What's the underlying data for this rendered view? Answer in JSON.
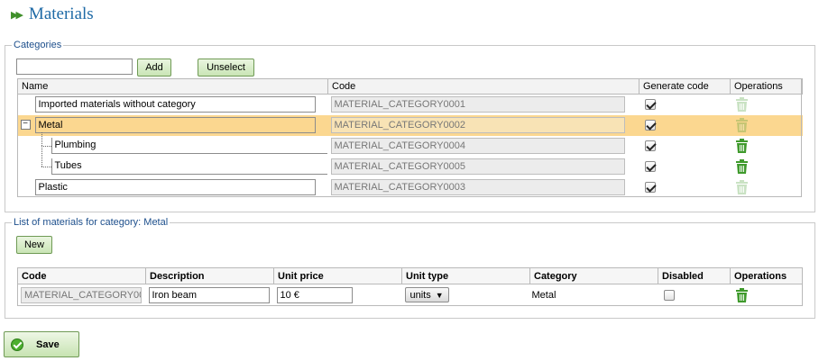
{
  "page": {
    "title": "Materials"
  },
  "categories": {
    "legend": "Categories",
    "search_value": "",
    "add_label": "Add",
    "unselect_label": "Unselect",
    "columns": {
      "name": "Name",
      "code": "Code",
      "generate_code": "Generate code",
      "operations": "Operations"
    },
    "rows": [
      {
        "name": "Imported materials without category",
        "code": "MATERIAL_CATEGORY0001",
        "generate_code": true,
        "deletable": false
      },
      {
        "name": "Metal",
        "code": "MATERIAL_CATEGORY0002",
        "generate_code": true,
        "deletable": false,
        "selected": true,
        "expanded": true
      },
      {
        "name": "Plumbing",
        "code": "MATERIAL_CATEGORY0004",
        "generate_code": true,
        "deletable": true,
        "child": true
      },
      {
        "name": "Tubes",
        "code": "MATERIAL_CATEGORY0005",
        "generate_code": true,
        "deletable": true,
        "child": true
      },
      {
        "name": "Plastic",
        "code": "MATERIAL_CATEGORY0003",
        "generate_code": true,
        "deletable": false
      }
    ]
  },
  "materials": {
    "legend": "List of materials for category: Metal",
    "new_label": "New",
    "columns": {
      "code": "Code",
      "description": "Description",
      "unit_price": "Unit price",
      "unit_type": "Unit type",
      "category": "Category",
      "disabled": "Disabled",
      "operations": "Operations"
    },
    "rows": [
      {
        "code": "MATERIAL_CATEGORY00",
        "description": "Iron beam",
        "unit_price": "10 €",
        "unit_type": "units",
        "category": "Metal",
        "disabled": false
      }
    ]
  },
  "footer": {
    "save_label": "Save"
  },
  "colors": {
    "accent_green": "#4caf2e",
    "title_blue": "#1e6aa6",
    "selected_row": "#fbd790",
    "trash_green": "#3f9a2c"
  },
  "icons": {
    "title": "double-chevron-right-icon",
    "delete": "trash-icon",
    "save": "checkmark-circle-icon",
    "collapse": "minus-box-icon"
  }
}
